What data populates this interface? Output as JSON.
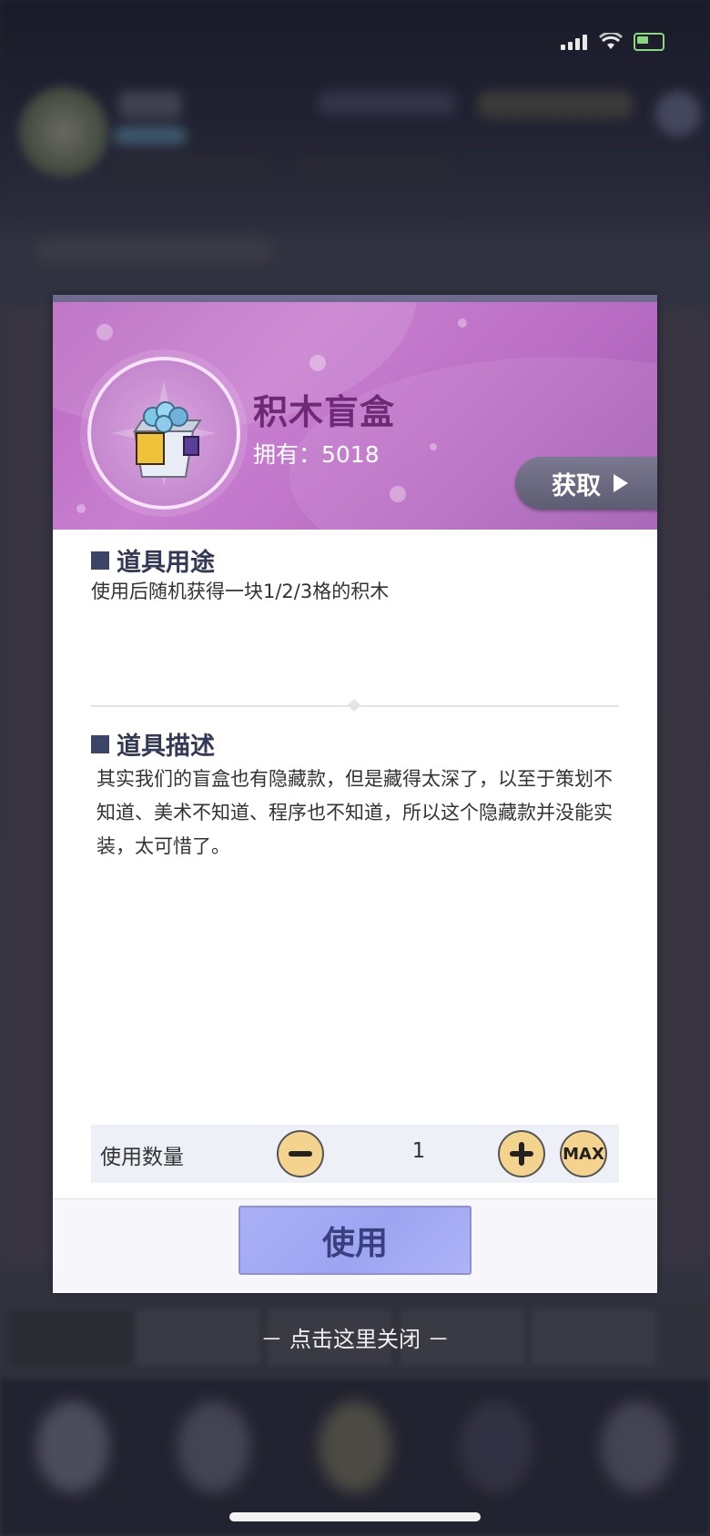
{
  "item": {
    "name": "积木盲盒",
    "owned_label": "拥有：5018",
    "obtain_label": "获取"
  },
  "usage": {
    "title": "道具用途",
    "text": "使用后随机获得一块1/2/3格的积木"
  },
  "description": {
    "title": "道具描述",
    "text": "其实我们的盲盒也有隐藏款，但是藏得太深了，以至于策划不知道、美术不知道、程序也不知道，所以这个隐藏款并没能实装，太可惜了。"
  },
  "quantity": {
    "label": "使用数量",
    "value": "1",
    "max_label": "MAX"
  },
  "use_button": "使用",
  "close_hint": "－ 点击这里关闭 －",
  "colors": {
    "header_purple": "#c07ac8",
    "item_name": "#6f2a76",
    "use_button": "#a9b0f6",
    "qty_button": "#f3d38e"
  },
  "icons": [
    "signal-icon",
    "wifi-icon",
    "battery-icon",
    "blind-box-icon",
    "play-icon",
    "minus-icon",
    "plus-icon"
  ]
}
